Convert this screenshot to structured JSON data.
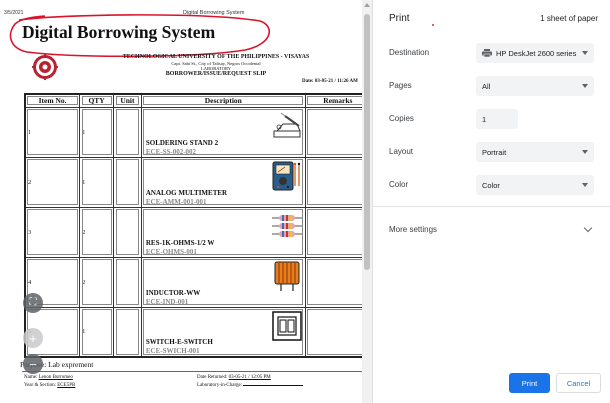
{
  "document": {
    "date": "3/5/2021",
    "header_title": "Digital Borrowing System",
    "main_title": "Digital Borrowing System",
    "institution": [
      "TECHNOLOGICAL UNIVERSITY OF THE PHILIPPINES - VISAYAS",
      "Capt. Sabi St., City of Talisay, Negros Occidental",
      "LABORATORY",
      "BORROWER/ISSUE/REQUEST SLIP"
    ],
    "date_line": "Date: 03-05-21 / 11:26 AM",
    "table_headers": [
      "Item No.",
      "QTY",
      "Unit",
      "Description",
      "Remarks"
    ],
    "rows": [
      {
        "item": "1",
        "qty": "1",
        "unit": "",
        "name": "SOLDERING STAND 2",
        "code": "ECE-SS-002-002",
        "icon": "soldering-stand-icon"
      },
      {
        "item": "2",
        "qty": "1",
        "unit": "",
        "name": "ANALOG MULTIMETER",
        "code": "ECE-AMM-001-001",
        "icon": "multimeter-icon"
      },
      {
        "item": "3",
        "qty": "2",
        "unit": "",
        "name": "RES-1K-OHMS-1/2 W",
        "code": "ECE-OHMS-001",
        "icon": "resistor-icon"
      },
      {
        "item": "4",
        "qty": "2",
        "unit": "",
        "name": "INDUCTOR-WW",
        "code": "ECE-IND-001",
        "icon": "inductor-icon"
      },
      {
        "item": "5",
        "qty": "1",
        "unit": "",
        "name": "SWITCH-E-SWITCH",
        "code": "ECE-SWICH-001",
        "icon": "switch-icon"
      }
    ],
    "purpose": "Purpose: Lab exprement",
    "name_label": "Name:",
    "name_value": "Lenon Borromeo",
    "year_label": "Year & Section:",
    "year_value": "ECE5PB",
    "returned_label": "Date Returned:",
    "returned_value": "03-05-21 / 12:05 PM",
    "incharge_label": "Laboratory-in-Charge:"
  },
  "zoom_controls": {
    "fit": "⛶",
    "plus": "+",
    "minus": "−"
  },
  "print_panel": {
    "title": "Print",
    "sheets": "1 sheet of paper",
    "destination_label": "Destination",
    "destination_value": "HP DeskJet 2600 series",
    "pages_label": "Pages",
    "pages_value": "All",
    "copies_label": "Copies",
    "copies_value": "1",
    "layout_label": "Layout",
    "layout_value": "Portrait",
    "color_label": "Color",
    "color_value": "Color",
    "more_settings": "More settings",
    "print_button": "Print",
    "cancel_button": "Cancel"
  },
  "colors": {
    "accent": "#1a73e8",
    "annotation": "#d9142a"
  }
}
